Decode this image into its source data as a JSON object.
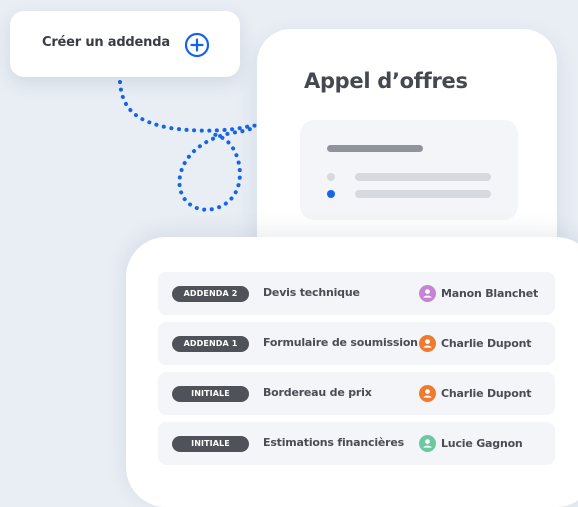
{
  "create_button": {
    "label": "Créer un addenda",
    "icon": "plus-circle-icon",
    "accent": "#1565e8"
  },
  "tender": {
    "title": "Appel d’offres",
    "active_dot_color": "#1565e8",
    "inactive_dot_color": "#d6d9de"
  },
  "documents": [
    {
      "badge": "ADDENDA 2",
      "name": "Devis technique",
      "user": "Manon Blanchet",
      "avatar_color": "#c784d6"
    },
    {
      "badge": "ADDENDA 1",
      "name": "Formulaire de soumission",
      "user": "Charlie Dupont",
      "avatar_color": "#f07b2e"
    },
    {
      "badge": "INITIALE",
      "name": "Bordereau de prix",
      "user": "Charlie Dupont",
      "avatar_color": "#f07b2e"
    },
    {
      "badge": "INITIALE",
      "name": "Estimations financières",
      "user": "Lucie Gagnon",
      "avatar_color": "#6cc8a0"
    }
  ]
}
